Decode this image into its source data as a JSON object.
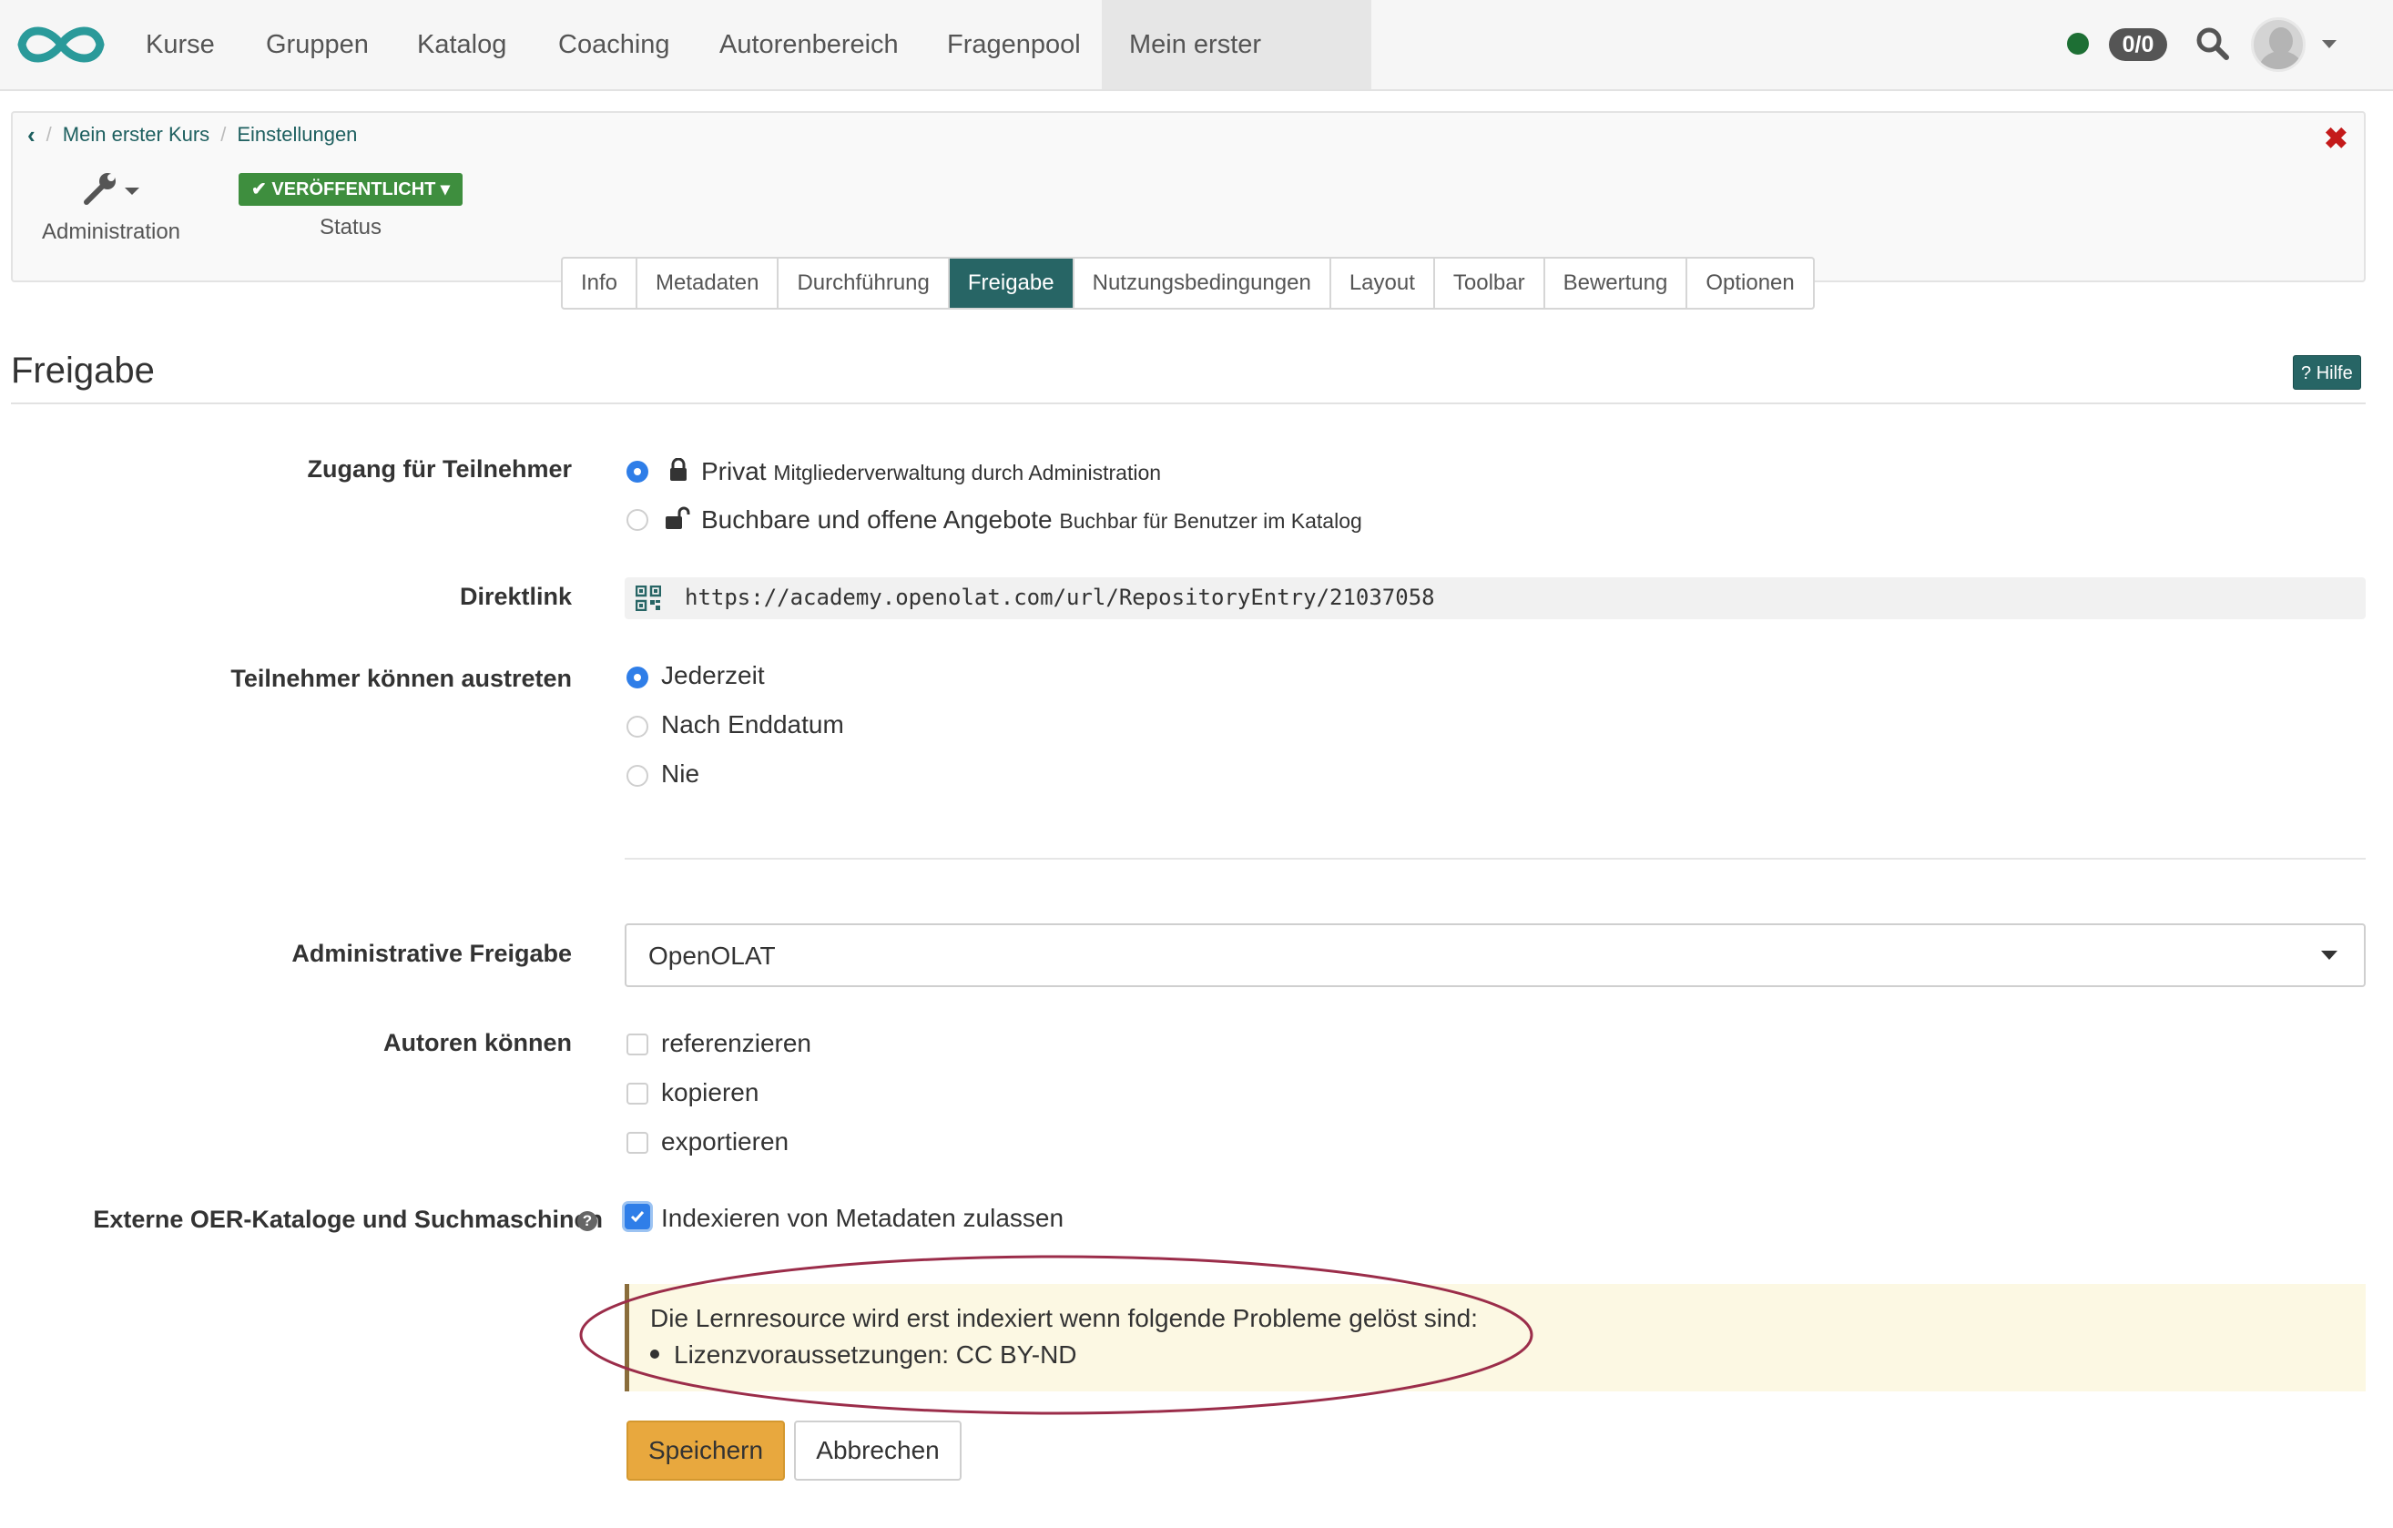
{
  "topnav": {
    "items": [
      {
        "label": "Kurse"
      },
      {
        "label": "Gruppen"
      },
      {
        "label": "Katalog"
      },
      {
        "label": "Coaching"
      },
      {
        "label": "Autorenbereich"
      },
      {
        "label": "Fragenpool"
      },
      {
        "label": "Mein erster Kurs"
      }
    ],
    "badge_count": "0/0",
    "status_color": "#1d6f34",
    "logo_icon": "openolat-infinity-logo"
  },
  "breadcrumb": {
    "items": [
      "Mein erster Kurs",
      "Einstellungen"
    ],
    "separator": "/"
  },
  "toolbar": {
    "admin_label": "Administration",
    "status_button": "VERÖFFENTLICHT",
    "status_label": "Status"
  },
  "tabs": [
    {
      "label": "Info"
    },
    {
      "label": "Metadaten"
    },
    {
      "label": "Durchführung"
    },
    {
      "label": "Freigabe"
    },
    {
      "label": "Nutzungsbedingungen"
    },
    {
      "label": "Layout"
    },
    {
      "label": "Toolbar"
    },
    {
      "label": "Bewertung"
    },
    {
      "label": "Optionen"
    }
  ],
  "active_tab": "Freigabe",
  "section": {
    "title": "Freigabe",
    "help_label": "Hilfe"
  },
  "form": {
    "access": {
      "label": "Zugang für Teilnehmer",
      "options": [
        {
          "title": "Privat",
          "desc": "Mitgliederverwaltung durch Administration",
          "selected": true
        },
        {
          "title": "Buchbare und offene Angebote",
          "desc": "Buchbar für Benutzer im Katalog",
          "selected": false
        }
      ]
    },
    "directlink": {
      "label": "Direktlink",
      "url": "https://academy.openolat.com/url/RepositoryEntry/21037058"
    },
    "leave": {
      "label": "Teilnehmer können austreten",
      "options": [
        {
          "title": "Jederzeit",
          "selected": true
        },
        {
          "title": "Nach Enddatum",
          "selected": false
        },
        {
          "title": "Nie",
          "selected": false
        }
      ]
    },
    "admin_share": {
      "label": "Administrative Freigabe",
      "value": "OpenOLAT"
    },
    "authors": {
      "label": "Autoren können",
      "options": [
        {
          "title": "referenzieren",
          "checked": false
        },
        {
          "title": "kopieren",
          "checked": false
        },
        {
          "title": "exportieren",
          "checked": false
        }
      ]
    },
    "oer": {
      "label": "Externe OER-Kataloge und Suchmaschinen",
      "option": "Indexieren von Metadaten zulassen",
      "checked": true
    },
    "warning": {
      "text": "Die Lernresource wird erst indexiert wenn folgende Probleme gelöst sind:",
      "items": [
        "Lizenzvoraussetzungen: CC BY-ND"
      ]
    },
    "buttons": {
      "save": "Speichern",
      "cancel": "Abbrechen"
    }
  },
  "colors": {
    "accent": "#276565",
    "primary_button": "#e8a83e",
    "published": "#3e8e3e",
    "close": "#c41a1a",
    "radio_selected": "#2f7ee8",
    "warning_bg": "#fcf8e3",
    "annotation_ellipse": "#9b2d4a"
  }
}
